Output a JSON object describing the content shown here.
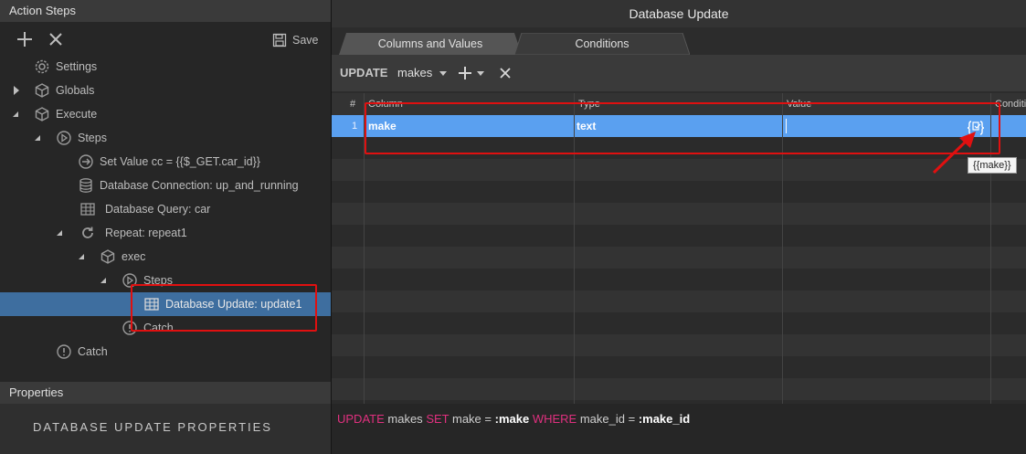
{
  "left": {
    "header": "Action Steps",
    "toolbar": {
      "add_icon": "plus-icon",
      "remove_icon": "close-icon",
      "save_label": "Save"
    },
    "tree": [
      {
        "label": "Settings",
        "icon": "gear-icon"
      },
      {
        "label": "Globals",
        "icon": "cube-icon"
      },
      {
        "label": "Execute",
        "icon": "cube-icon"
      },
      {
        "label": "Steps",
        "icon": "play-circle-icon"
      },
      {
        "label": "Set Value cc = {{$_GET.car_id}}",
        "icon": "arrow-circle-icon"
      },
      {
        "label": "Database Connection: up_and_running",
        "icon": "database-icon"
      },
      {
        "label": "Database Query: car",
        "icon": "table-icon"
      },
      {
        "label": "Repeat: repeat1",
        "icon": "repeat-icon"
      },
      {
        "label": "exec",
        "icon": "cube-icon"
      },
      {
        "label": "Steps",
        "icon": "play-circle-icon"
      },
      {
        "label": "Database Update: update1",
        "icon": "table-icon"
      },
      {
        "label": "Catch",
        "icon": "alert-circle-icon"
      },
      {
        "label": "Catch",
        "icon": "alert-circle-icon"
      }
    ],
    "properties_header": "Properties",
    "properties_title": "DATABASE UPDATE PROPERTIES"
  },
  "right": {
    "title": "Database Update",
    "tabs": [
      {
        "label": "Columns and Values",
        "active": true
      },
      {
        "label": "Conditions",
        "active": false
      }
    ],
    "update_bar": {
      "keyword": "UPDATE",
      "table": "makes"
    },
    "grid": {
      "headers": [
        "#",
        "Column",
        "Type",
        "Value",
        "Conditi"
      ],
      "rows": [
        {
          "num": "1",
          "column": "make",
          "type": "text",
          "value": ""
        }
      ]
    },
    "tooltip": "{{make}}",
    "sql": {
      "k1": "UPDATE",
      "t1": "makes",
      "k2": "SET",
      "t2": "make =",
      "p1": ":make",
      "k3": "WHERE",
      "t3": "make_id =",
      "p2": ":make_id"
    }
  },
  "colors": {
    "accent": "#3e6e9f",
    "row_selected": "#5aa0f0",
    "highlight": "#e01010",
    "sql_keyword": "#e0307f"
  }
}
